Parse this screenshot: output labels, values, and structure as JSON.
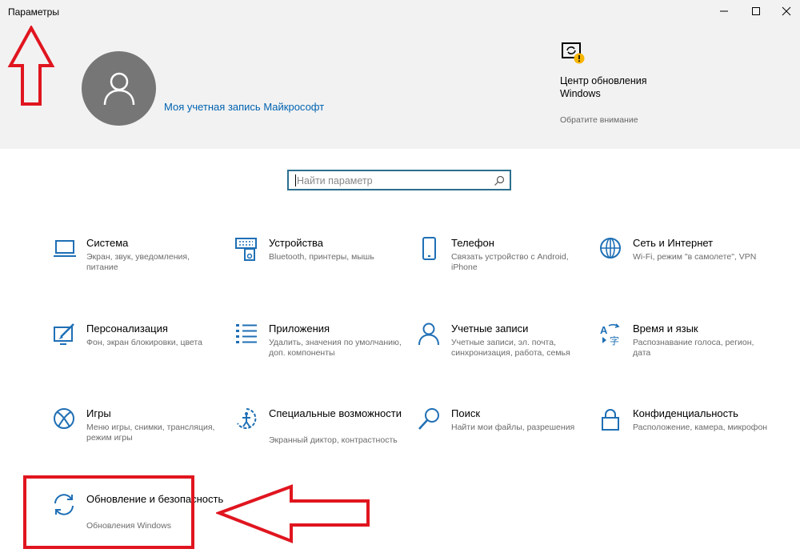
{
  "window": {
    "title": "Параметры"
  },
  "account": {
    "link_text": "Моя учетная запись Майкрософт"
  },
  "update_center": {
    "title": "Центр обновления Windows",
    "subtitle": "Обратите внимание"
  },
  "search": {
    "placeholder": "Найти параметр"
  },
  "tiles": [
    {
      "title": "Система",
      "desc": "Экран, звук, уведомления, питание",
      "icon": "laptop-icon"
    },
    {
      "title": "Устройства",
      "desc": "Bluetooth, принтеры, мышь",
      "icon": "keyboard-speaker-icon"
    },
    {
      "title": "Телефон",
      "desc": "Связать устройство с Android, iPhone",
      "icon": "phone-icon"
    },
    {
      "title": "Сеть и Интернет",
      "desc": "Wi-Fi, режим \"в самолете\", VPN",
      "icon": "globe-icon"
    },
    {
      "title": "Персонализация",
      "desc": "Фон, экран блокировки, цвета",
      "icon": "paint-icon"
    },
    {
      "title": "Приложения",
      "desc": "Удалить, значения по умолчанию, доп. компоненты",
      "icon": "apps-list-icon"
    },
    {
      "title": "Учетные записи",
      "desc": "Учетные записи, эл. почта, синхронизация, работа, семья",
      "icon": "person-icon"
    },
    {
      "title": "Время и язык",
      "desc": "Распознавание голоса, регион, дата",
      "icon": "time-language-icon"
    },
    {
      "title": "Игры",
      "desc": "Меню игры, снимки, трансляция, режим игры",
      "icon": "xbox-icon"
    },
    {
      "title": "Специальные возможности",
      "desc": "Экранный диктор, контрастность",
      "icon": "accessibility-icon"
    },
    {
      "title": "Поиск",
      "desc": "Найти мои файлы, разрешения",
      "icon": "search-icon"
    },
    {
      "title": "Конфиденциальность",
      "desc": "Расположение, камера, микрофон",
      "icon": "lock-icon"
    },
    {
      "title": "Обновление и безопасность",
      "desc": "Обновления Windows",
      "icon": "sync-icon"
    }
  ],
  "colors": {
    "accent": "#0063b1",
    "icon": "#1f6fb5",
    "annotation": "#e0151f",
    "header_bg": "#f2f2f2"
  }
}
